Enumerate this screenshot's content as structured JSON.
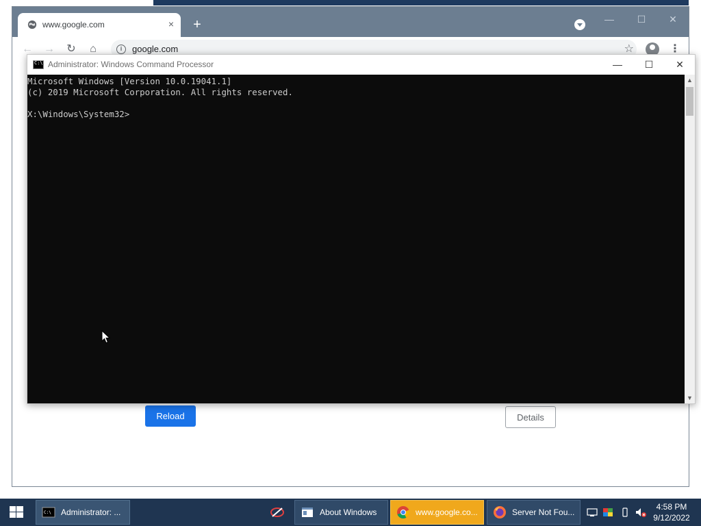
{
  "chrome": {
    "tab_title": "www.google.com",
    "tab_close_glyph": "×",
    "new_tab_glyph": "+",
    "minimize_glyph": "—",
    "maximize_glyph": "☐",
    "close_glyph": "✕",
    "back_glyph": "←",
    "forward_glyph": "→",
    "reload_glyph": "↻",
    "home_glyph": "⌂",
    "address": "google.com",
    "star_glyph": "☆",
    "menu_glyph": "⋮",
    "reload_button": "Reload",
    "details_button": "Details"
  },
  "cmd": {
    "title": "Administrator: Windows Command Processor",
    "minimize_glyph": "—",
    "maximize_glyph": "☐",
    "close_glyph": "✕",
    "lines": [
      "Microsoft Windows [Version 10.0.19041.1]",
      "(c) 2019 Microsoft Corporation. All rights reserved.",
      "",
      "X:\\Windows\\System32>"
    ],
    "scroll_up_glyph": "▲",
    "scroll_down_glyph": "▼"
  },
  "taskbar": {
    "items": [
      {
        "label": "Administrator: ...",
        "icon": "cmd-icon"
      },
      {
        "label": "About Windows",
        "icon": "window-icon"
      },
      {
        "label": "www.google.co...",
        "icon": "chrome-icon"
      },
      {
        "label": "Server Not Fou...",
        "icon": "firefox-icon"
      }
    ],
    "time": "4:58 PM",
    "date": "9/12/2022"
  },
  "colors": {
    "chrome_frame": "#6c7e91",
    "taskbar": "#1f3551",
    "reload_blue": "#1a73e8",
    "chrome_task_highlight": "#f0a81c"
  }
}
